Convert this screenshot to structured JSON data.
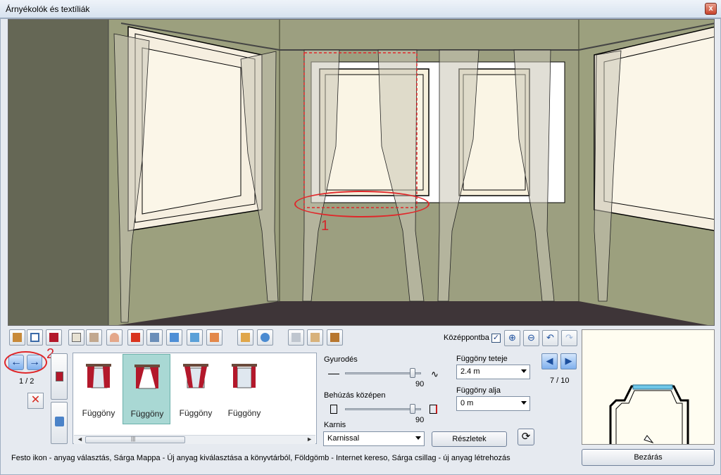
{
  "window": {
    "title": "Árnyékolók és textíliák",
    "close_glyph": "x"
  },
  "annotations": {
    "marker1": "1",
    "marker2": "2"
  },
  "toolbar": {
    "center_label": "Középpontba",
    "center_checked": true,
    "center_check_glyph": "✓"
  },
  "left_nav": {
    "prev_glyph": "←",
    "next_glyph": "→",
    "page": "1 / 2",
    "delete_glyph": "✕"
  },
  "gallery": {
    "items": [
      {
        "label": "Függöny",
        "selected": false
      },
      {
        "label": "Függöny",
        "selected": true
      },
      {
        "label": "Függöny",
        "selected": false
      },
      {
        "label": "Függöny",
        "selected": false
      }
    ],
    "scroll_left": "◄",
    "scroll_right": "►",
    "scroll_grip": "|||"
  },
  "props": {
    "gyurodes_label": "Gyurodés",
    "gyurodes_value": "90",
    "behuzas_label": "Behúzás középen",
    "behuzas_value": "90",
    "karnis_label": "Karnis",
    "karnis_value": "Karnissal",
    "top_label": "Függöny teteje",
    "top_value": "2.4 m",
    "bottom_label": "Függöny alja",
    "bottom_value": "0 m",
    "details_button": "Részletek"
  },
  "right_nav": {
    "page": "7 / 10"
  },
  "status": "Festo ikon - anyag választás, Sárga Mappa - Új anyag kiválasztása a könyvtárból, Földgömb - Internet kereso, Sárga csillag - új anyag létrehozás",
  "close_button": "Bezárás",
  "colors": {
    "wall": "#9a9f7e",
    "floor": "#3d3537",
    "curtain_red": "#b3182b",
    "selection": "#a9d8d4",
    "annotation_red": "#e0272a"
  }
}
